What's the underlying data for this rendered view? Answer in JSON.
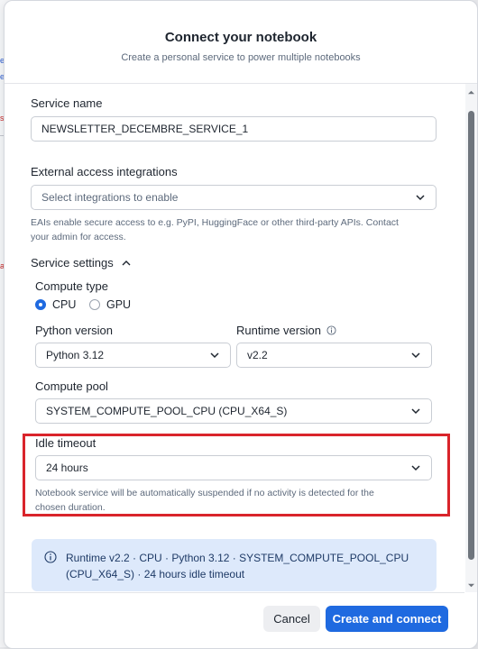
{
  "dialog": {
    "title": "Connect your notebook",
    "subtitle": "Create a personal service to power multiple notebooks"
  },
  "service_name": {
    "label": "Service name",
    "value": "NEWSLETTER_DECEMBRE_SERVICE_1"
  },
  "external_access": {
    "label": "External access integrations",
    "placeholder": "Select integrations to enable",
    "help_line1": "EAIs enable secure access to e.g. PyPI, HuggingFace or other third-party APIs. Contact",
    "help_line2": "your admin for access."
  },
  "service_settings": {
    "label": "Service settings",
    "expanded": true
  },
  "compute_type": {
    "label": "Compute type",
    "options": [
      "CPU",
      "GPU"
    ],
    "selected": "CPU"
  },
  "python_version": {
    "label": "Python version",
    "value": "Python 3.12"
  },
  "runtime_version": {
    "label": "Runtime version",
    "value": "v2.2"
  },
  "compute_pool": {
    "label": "Compute pool",
    "value": "SYSTEM_COMPUTE_POOL_CPU (CPU_X64_S)"
  },
  "idle_timeout": {
    "label": "Idle timeout",
    "value": "24 hours",
    "help_line1": "Notebook service will be automatically suspended if no activity is detected for the",
    "help_line2": "chosen duration."
  },
  "summary": {
    "line1": "Runtime v2.2 · CPU · Python 3.12 · SYSTEM_COMPUTE_POOL_CPU",
    "line2": "(CPU_X64_S) · 24 hours idle timeout"
  },
  "footer": {
    "cancel_label": "Cancel",
    "create_label": "Create and connect"
  },
  "colors": {
    "primary": "#1f6ae0",
    "highlight": "#d9242b",
    "info_bg": "#dde9fb"
  }
}
